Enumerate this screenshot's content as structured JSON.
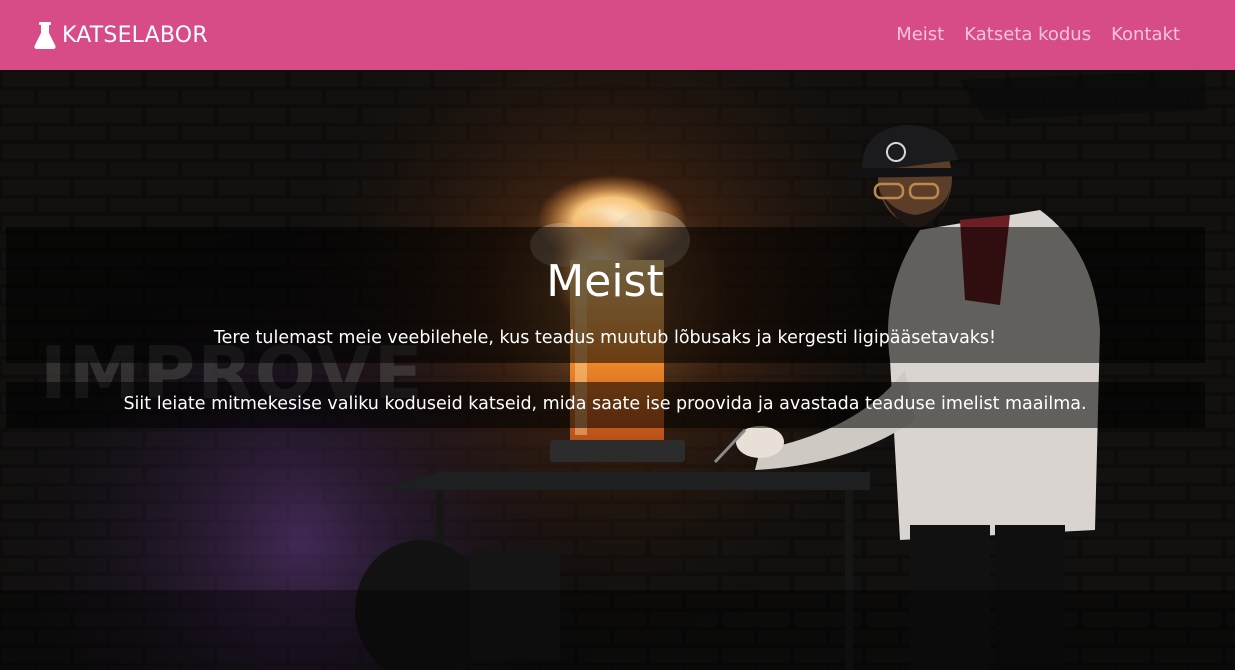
{
  "brand": {
    "name": "KATSELABOR",
    "icon": "flask-icon"
  },
  "nav": {
    "items": [
      {
        "label": "Meist"
      },
      {
        "label": "Katseta kodus"
      },
      {
        "label": "Kontakt"
      }
    ]
  },
  "colors": {
    "navbar": "#d74b87",
    "nav_link": "#f3c3d9",
    "flame": "#f08a2a"
  },
  "hero": {
    "title": "Meist",
    "intro": "Tere tulemast meie veebilehele, kus teadus muutub lõbusaks ja kergesti ligipääsetavaks!",
    "description": "Siit leiate mitmekesise valiku koduseid katseid, mida saate ise proovida ja avastada teaduse imelist maailma.",
    "background_image": "scientist-flame-experiment-photo",
    "background_wall_text": "IMPROVE"
  }
}
